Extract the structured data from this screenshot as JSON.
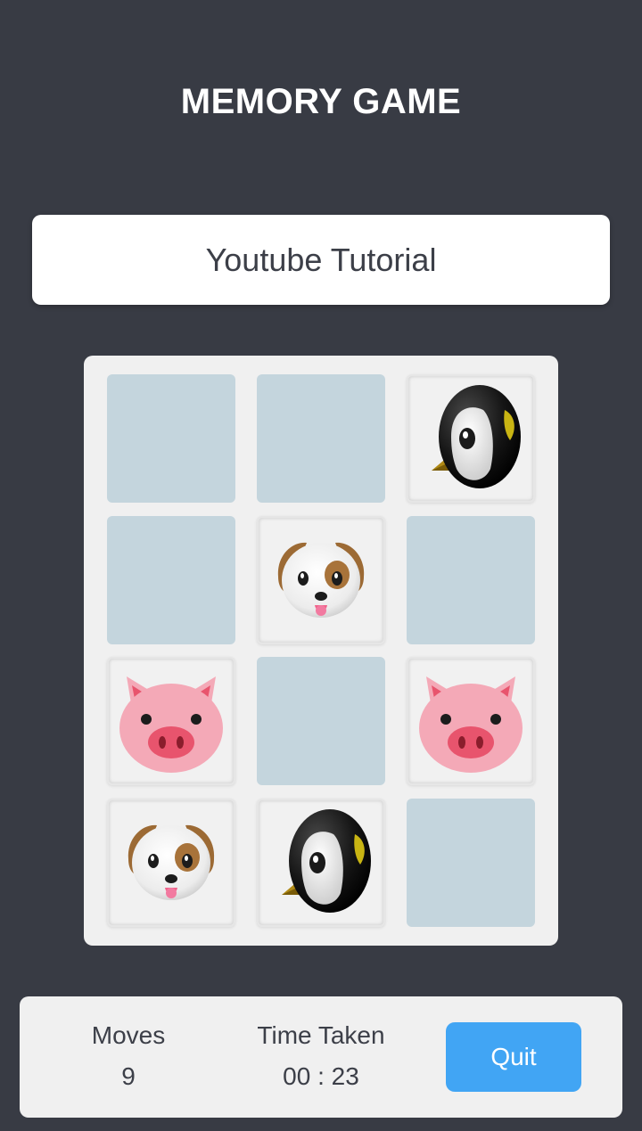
{
  "header": {
    "title": "MEMORY GAME"
  },
  "tutorial": {
    "label": "Youtube Tutorial"
  },
  "colors": {
    "background": "#383b44",
    "card_hidden": "#c4d5dd",
    "card_shown": "#f1f1f1",
    "quit_button": "#41a5f4"
  },
  "board": {
    "columns": 3,
    "rows": 4,
    "cards": [
      {
        "state": "hidden",
        "icon": ""
      },
      {
        "state": "hidden",
        "icon": ""
      },
      {
        "state": "shown",
        "icon": "penguin-icon"
      },
      {
        "state": "hidden",
        "icon": ""
      },
      {
        "state": "shown",
        "icon": "dog-icon"
      },
      {
        "state": "hidden",
        "icon": ""
      },
      {
        "state": "shown",
        "icon": "pig-icon"
      },
      {
        "state": "hidden",
        "icon": ""
      },
      {
        "state": "shown",
        "icon": "pig-icon"
      },
      {
        "state": "shown",
        "icon": "dog-icon"
      },
      {
        "state": "shown",
        "icon": "penguin-icon"
      },
      {
        "state": "hidden",
        "icon": ""
      }
    ]
  },
  "stats": {
    "moves_label": "Moves",
    "moves_value": "9",
    "time_label": "Time Taken",
    "time_value": "00 : 23"
  },
  "actions": {
    "quit_label": "Quit"
  }
}
